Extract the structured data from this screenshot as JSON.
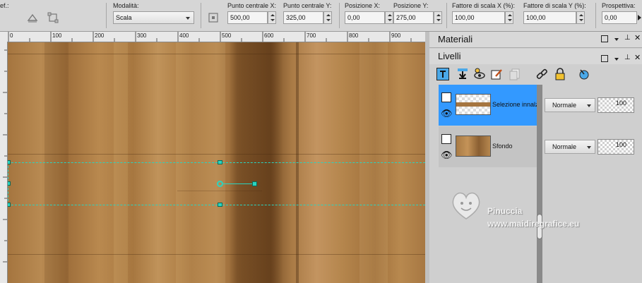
{
  "toolbar": {
    "cut_label": "ef.:",
    "mode_label": "Modalità:",
    "mode_value": "Scala",
    "center_x_label": "Punto centrale X:",
    "center_x_value": "500,00",
    "center_y_label": "Punto centrale Y:",
    "center_y_value": "325,00",
    "pos_x_label": "Posizione X:",
    "pos_x_value": "0,00",
    "pos_y_label": "Posizione Y:",
    "pos_y_value": "275,00",
    "scale_x_label": "Fattore di scala X (%):",
    "scale_x_value": "100,00",
    "scale_y_label": "Fattore di scala Y (%):",
    "scale_y_value": "100,00",
    "perspective_label": "Prospettiva:",
    "perspective_value": "0,00"
  },
  "ruler": {
    "ticks": [
      "0",
      "100",
      "200",
      "300",
      "400",
      "500",
      "600",
      "700",
      "800",
      "900"
    ]
  },
  "materials": {
    "title": "Materiali"
  },
  "layers": {
    "title": "Livelli",
    "items": [
      {
        "name": "Selezione innalzata",
        "blend": "Normale",
        "opacity": "100"
      },
      {
        "name": "Sfondo",
        "blend": "Normale",
        "opacity": "100"
      }
    ]
  },
  "watermark": {
    "name": "Pinuccia",
    "site": "www.maidiregrafice.eu"
  },
  "colors": {
    "selected_layer": "#3399ff",
    "guide": "#2ad4c0",
    "accent": "#3399ff"
  }
}
